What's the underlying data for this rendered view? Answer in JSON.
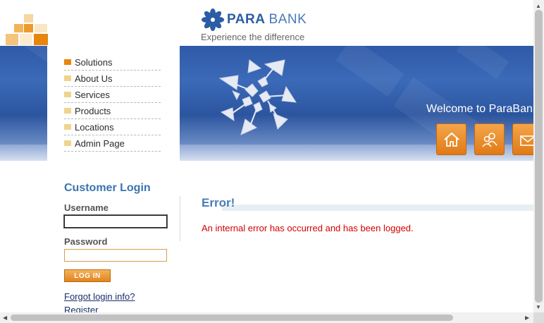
{
  "brand": {
    "name_bold": "PARA",
    "name_light": "BANK",
    "tagline": "Experience the difference"
  },
  "header": {
    "welcome": "Welcome to ParaBank",
    "nav_icons": [
      "home-icon",
      "about-icon",
      "contact-icon"
    ]
  },
  "menu": {
    "items": [
      {
        "label": "Solutions",
        "active": true
      },
      {
        "label": "About Us"
      },
      {
        "label": "Services"
      },
      {
        "label": "Products"
      },
      {
        "label": "Locations"
      },
      {
        "label": "Admin Page"
      }
    ]
  },
  "login": {
    "title": "Customer Login",
    "username_label": "Username",
    "username_value": "",
    "password_label": "Password",
    "password_value": "",
    "button_label": "LOG IN",
    "forgot_link": "Forgot login info?",
    "register_link": "Register"
  },
  "error": {
    "heading": "Error!",
    "message": "An internal error has occurred and has been logged."
  },
  "colors": {
    "accent_orange": "#e8850c",
    "heading_blue": "#3a74b0",
    "error_red": "#d40000"
  }
}
